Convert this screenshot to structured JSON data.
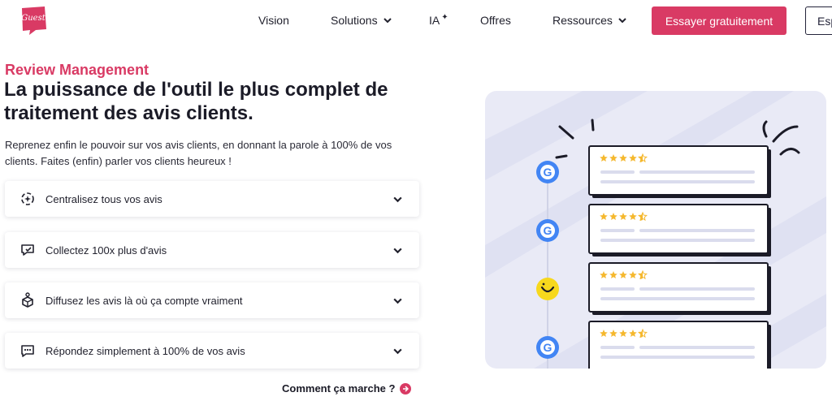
{
  "header": {
    "logo_text": "Guest",
    "nav": [
      {
        "label": "Vision",
        "has_dropdown": false
      },
      {
        "label": "Solutions",
        "has_dropdown": true
      },
      {
        "label": "IA",
        "has_dropdown": false
      },
      {
        "label": "Offres",
        "has_dropdown": false
      },
      {
        "label": "Ressources",
        "has_dropdown": true
      }
    ],
    "cta_primary": "Essayer gratuitement",
    "cta_secondary": "Esp"
  },
  "hero": {
    "eyebrow": "Review Management",
    "headline": "La puissance de l'outil le plus complet de traitement des avis clients.",
    "intro": "Reprenez enfin le pouvoir sur vos avis clients, en donnant la parole à 100% de vos clients. Faites (enfin) parler vos clients heureux !"
  },
  "features": [
    {
      "label": "Centralisez tous vos avis",
      "icon": "centralize-icon"
    },
    {
      "label": "Collectez 100x plus d'avis",
      "icon": "collect-icon"
    },
    {
      "label": "Diffusez les avis là où ça compte vraiment",
      "icon": "broadcast-icon"
    },
    {
      "label": "Répondez simplement à 100% de vos avis",
      "icon": "reply-icon"
    }
  ],
  "how_link": "Comment ça marche ?",
  "illustration": {
    "review_cards": [
      {
        "source": "google-icon",
        "stars": 4.5
      },
      {
        "source": "google-icon",
        "stars": 4.5
      },
      {
        "source": "smiley-icon",
        "stars": 4.5
      },
      {
        "source": "google-icon",
        "stars": 4.5
      }
    ]
  },
  "colors": {
    "brand_pink": "#d93a64",
    "google_blue": "#4285f4",
    "star_yellow": "#f5b82e",
    "smiley_yellow": "#f7d81d",
    "illustration_bg": "#e9eaf6"
  }
}
